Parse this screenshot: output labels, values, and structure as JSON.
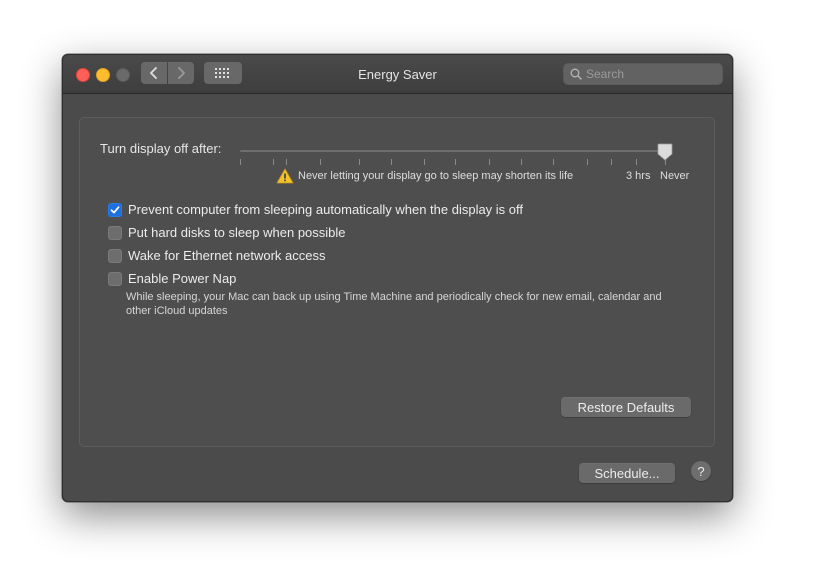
{
  "window": {
    "title": "Energy Saver"
  },
  "toolbar": {
    "back_icon": "chevron-left-icon",
    "forward_icon": "chevron-right-icon",
    "grid_icon": "show-all-grid-icon"
  },
  "search": {
    "placeholder": "Search",
    "value": ""
  },
  "display_sleep": {
    "label": "Turn display off after:",
    "value": "Never",
    "warning": "Never letting your display go to sleep may shorten its life",
    "tick_labels": [
      "3 hrs",
      "Never"
    ]
  },
  "options": [
    {
      "label": "Prevent computer from sleeping automatically when the display is off",
      "checked": true
    },
    {
      "label": "Put hard disks to sleep when possible",
      "checked": false
    },
    {
      "label": "Wake for Ethernet network access",
      "checked": false
    },
    {
      "label": "Enable Power Nap",
      "checked": false
    }
  ],
  "power_nap_description": "While sleeping, your Mac can back up using Time Machine and periodically check for new email, calendar and other iCloud updates",
  "buttons": {
    "restore_defaults": "Restore Defaults",
    "schedule": "Schedule...",
    "help": "?"
  },
  "colors": {
    "accent": "#1f6fdc",
    "close": "#fe5f57",
    "minimize": "#febc2e",
    "warning": "#f2c230"
  }
}
